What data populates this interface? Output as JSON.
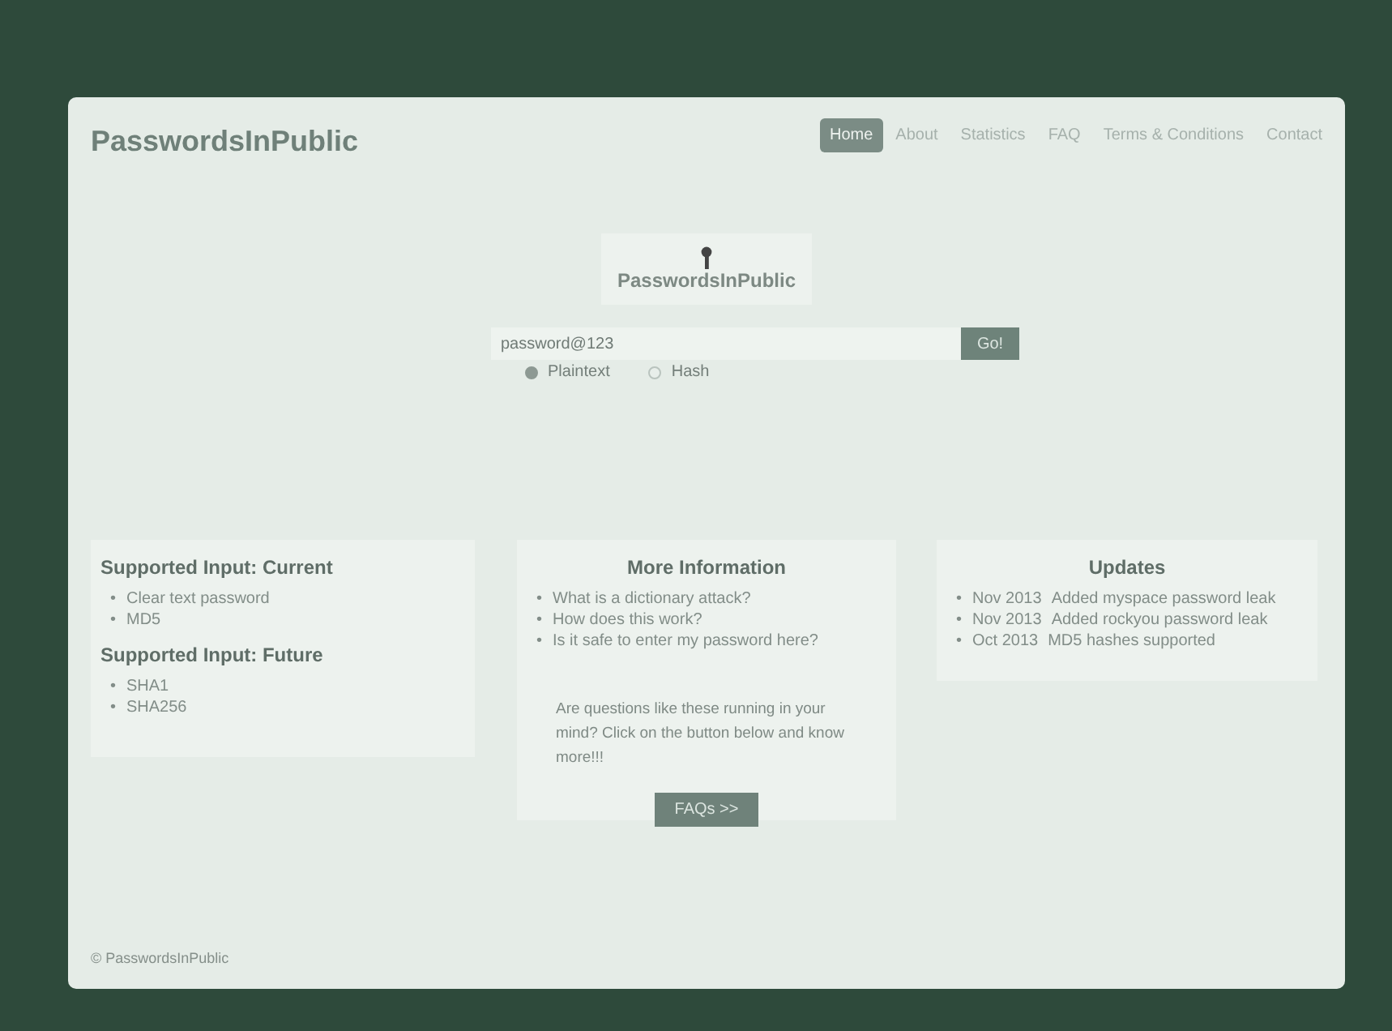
{
  "brand": "PasswordsInPublic",
  "nav": [
    {
      "label": "Home",
      "selected": true
    },
    {
      "label": "About",
      "selected": false
    },
    {
      "label": "Statistics",
      "selected": false
    },
    {
      "label": "FAQ",
      "selected": false
    },
    {
      "label": "Terms & Conditions",
      "selected": false
    },
    {
      "label": "Contact",
      "selected": false
    }
  ],
  "logo": {
    "text": "PasswordsInPublic"
  },
  "search": {
    "value": "password@123",
    "button": "Go!"
  },
  "input_type": [
    {
      "label": "Plaintext",
      "selected": true
    },
    {
      "label": "Hash",
      "selected": false
    }
  ],
  "supported": [
    {
      "heading": "Supported Input: Current",
      "items": [
        "Clear text password",
        "MD5"
      ]
    },
    {
      "heading": "Supported Input: Future",
      "items": [
        "SHA1",
        "SHA256"
      ]
    }
  ],
  "more_info": {
    "heading": "More Information",
    "links": [
      "What is a dictionary attack?",
      "How does this work?",
      "Is it safe to enter my password here?"
    ],
    "text": "Are questions like these running in your mind? Click on the button below and know more!!!",
    "button": "FAQs >>"
  },
  "updates": {
    "heading": "Updates",
    "items": [
      {
        "date": "Nov 2013",
        "text": "Added myspace password leak"
      },
      {
        "date": "Nov 2013",
        "text": "Added rockyou password leak"
      },
      {
        "date": "Oct 2013",
        "text": "MD5 hashes supported"
      }
    ]
  },
  "list_marker": "•",
  "footer": "© PasswordsInPublic"
}
